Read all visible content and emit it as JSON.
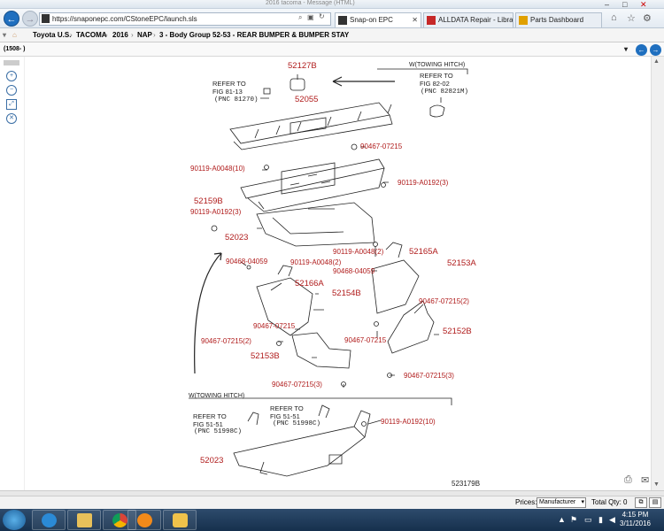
{
  "window": {
    "title": "2016 tacoma - Message (HTML)"
  },
  "browser": {
    "url": "https://snaponepc.com/CStoneEPC/launch.sls",
    "tabs": [
      {
        "label": "Snap-on EPC",
        "active": true
      },
      {
        "label": "ALLDATA Repair - Library ...",
        "active": false
      },
      {
        "label": "Parts Dashboard",
        "active": false
      }
    ]
  },
  "breadcrumb": [
    "Toyota U.S.",
    "TACOMA",
    "2016",
    "NAP",
    "3 - Body Group",
    "52-53 - REAR BUMPER & BUMPER STAY"
  ],
  "filter": {
    "value": "(1508- )"
  },
  "diagram": {
    "header_top": "W(TOWING HITCH)",
    "header_bottom": "W(TOWING HITCH)",
    "refs": [
      {
        "line1": "REFER TO",
        "line2": "FIG 81-13",
        "pnc": "(PNC 81270)"
      },
      {
        "line1": "REFER TO",
        "line2": "FIG 82-02",
        "pnc": "(PNC 82821M)"
      },
      {
        "line1": "REFER TO",
        "line2": "FIG 51-51",
        "pnc": "(PNC 51998C)"
      },
      {
        "line1": "REFER TO",
        "line2": "FIG 51-51",
        "pnc": "(PNC 51998C)"
      }
    ],
    "parts": [
      "52127B",
      "52055",
      "90467-07215",
      "90119-A0048(10)",
      "90119-A0192(3)",
      "52159B",
      "90119-A0192(3)",
      "52023",
      "90119-A0048(2)",
      "52165A",
      "52153A",
      "90468-04059",
      "90119-A0048(2)",
      "90468-04059",
      "52166A",
      "52154B",
      "90467-07215(2)",
      "90467-07215",
      "90467-07215(2)",
      "90467-07215",
      "52152B",
      "52153B",
      "90467-07215(3)",
      "90467-07215(3)",
      "90119-A0192(10)",
      "52023"
    ],
    "figure_number": "523179B"
  },
  "pricebar": {
    "prices_label": "Prices:",
    "prices_value": "Manufacturer",
    "total_qty": "Total Qty: 0"
  },
  "taskbar": {
    "time": "4:15 PM",
    "date": "3/11/2016"
  }
}
